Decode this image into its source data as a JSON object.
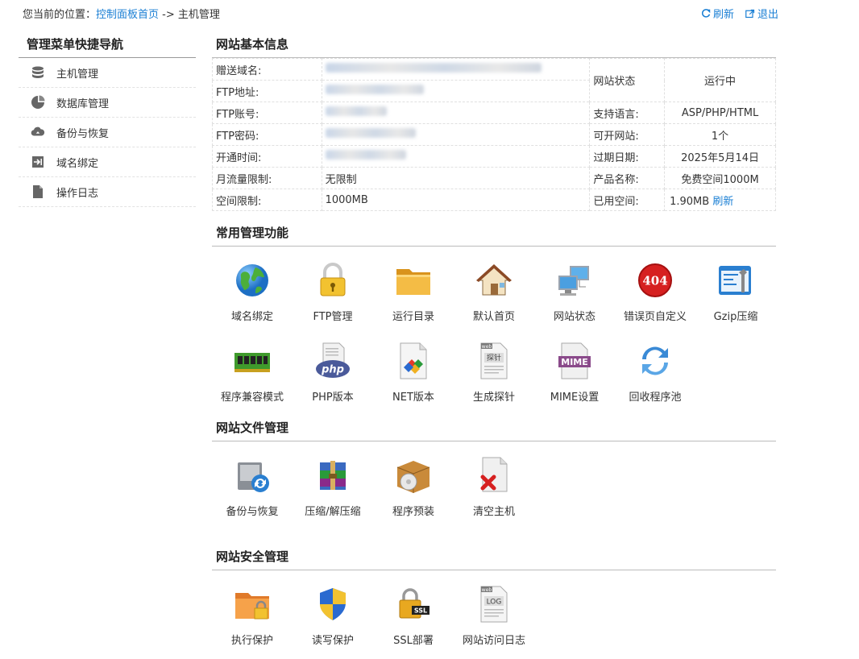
{
  "breadcrumb": {
    "prefix": "您当前的位置：",
    "home_link": "控制面板首页",
    "separator": " -> ",
    "current": "主机管理"
  },
  "top_actions": {
    "refresh": "刷新",
    "logout": "退出"
  },
  "sidebar": {
    "title": "管理菜单快捷导航",
    "items": [
      {
        "label": "主机管理",
        "icon": "database-icon"
      },
      {
        "label": "数据库管理",
        "icon": "pie-chart-icon"
      },
      {
        "label": "备份与恢复",
        "icon": "cloud-icon"
      },
      {
        "label": "域名绑定",
        "icon": "login-arrow-icon"
      },
      {
        "label": "操作日志",
        "icon": "document-icon"
      }
    ]
  },
  "info": {
    "title": "网站基本信息",
    "labels": {
      "domain": "赠送域名:",
      "ftp_addr": "FTP地址:",
      "ftp_user": "FTP账号:",
      "ftp_pass": "FTP密码:",
      "open_time": "开通时间:",
      "traffic": "月流量限制:",
      "space": "空间限制:",
      "status": "网站状态",
      "lang": "支持语言:",
      "sites": "可开网站:",
      "expire": "过期日期:",
      "product": "产品名称:",
      "used": "已用空间:"
    },
    "values": {
      "traffic": "无限制",
      "space": "1000MB",
      "status": "运行中",
      "lang": "ASP/PHP/HTML",
      "sites": "1个",
      "expire": "2025年5月14日",
      "product": "免费空间1000M",
      "used": "1.90MB",
      "used_refresh": "刷新"
    }
  },
  "common": {
    "title": "常用管理功能",
    "tiles": [
      {
        "label": "域名绑定",
        "icon": "globe-icon"
      },
      {
        "label": "FTP管理",
        "icon": "padlock-icon"
      },
      {
        "label": "运行目录",
        "icon": "folder-icon"
      },
      {
        "label": "默认首页",
        "icon": "house-icon"
      },
      {
        "label": "网站状态",
        "icon": "network-computers-icon"
      },
      {
        "label": "错误页自定义",
        "icon": "error-404-icon"
      },
      {
        "label": "Gzip压缩",
        "icon": "gzip-tool-icon"
      },
      {
        "label": "程序兼容模式",
        "icon": "memory-chip-icon"
      },
      {
        "label": "PHP版本",
        "icon": "php-icon"
      },
      {
        "label": "NET版本",
        "icon": "net-document-icon"
      },
      {
        "label": "生成探针",
        "icon": "probe-document-icon"
      },
      {
        "label": "MIME设置",
        "icon": "mime-document-icon"
      },
      {
        "label": "回收程序池",
        "icon": "recycle-arrows-icon"
      }
    ],
    "icon_text": {
      "err": "404",
      "php": "php",
      "mime": "MIME",
      "web": "web",
      "probe": "探针"
    }
  },
  "files": {
    "title": "网站文件管理",
    "tiles": [
      {
        "label": "备份与恢复",
        "icon": "backup-disk-icon"
      },
      {
        "label": "压缩/解压缩",
        "icon": "archive-books-icon"
      },
      {
        "label": "程序预装",
        "icon": "install-box-icon"
      },
      {
        "label": "清空主机",
        "icon": "delete-document-icon"
      }
    ]
  },
  "security": {
    "title": "网站安全管理",
    "tiles": [
      {
        "label": "执行保护",
        "icon": "locked-folder-icon"
      },
      {
        "label": "读写保护",
        "icon": "shield-icon"
      },
      {
        "label": "SSL部署",
        "icon": "ssl-lock-icon"
      },
      {
        "label": "网站访问日志",
        "icon": "log-document-icon"
      }
    ],
    "icon_text": {
      "ssl": "SSL",
      "web": "web",
      "log": "LOG"
    }
  },
  "colors": {
    "link": "#1a7fd4",
    "running": "#2a8a2a"
  }
}
